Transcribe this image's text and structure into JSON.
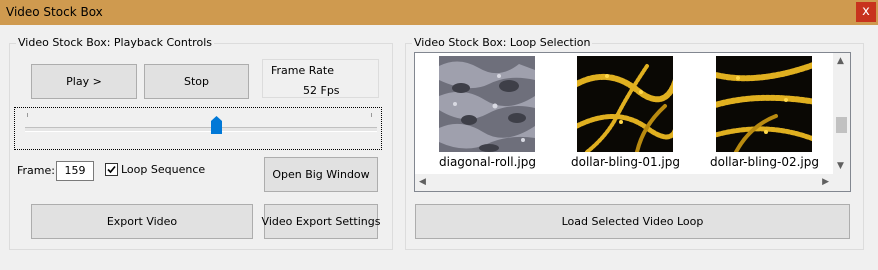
{
  "window": {
    "title": "Video Stock Box",
    "close_glyph": "x"
  },
  "playback": {
    "group_label": "Video Stock Box: Playback Controls",
    "play_label": "Play >",
    "stop_label": "Stop",
    "frame_rate_label": "Frame Rate",
    "frame_rate_value": "52 Fps",
    "slider_position_fraction": 0.54,
    "frame_label": "Frame:",
    "frame_value": "159",
    "loop_label": "Loop Sequence",
    "loop_checked": true,
    "open_big_label": "Open Big Window",
    "export_video_label": "Export Video",
    "export_settings_label": "Video Export Settings"
  },
  "loop_selection": {
    "group_label": "Video Stock Box: Loop Selection",
    "items": [
      {
        "caption": "diagonal-roll.jpg",
        "thumb": "gray-texture-thumbnail"
      },
      {
        "caption": "dollar-bling-01.jpg",
        "thumb": "gold-chain-thumbnail"
      },
      {
        "caption": "dollar-bling-02.jpg",
        "thumb": "gold-chain-thumbnail"
      }
    ],
    "load_label": "Load Selected Video Loop"
  },
  "colors": {
    "titlebar": "#cf9a4f",
    "close_button": "#c8331d",
    "slider_thumb": "#0078d7"
  }
}
